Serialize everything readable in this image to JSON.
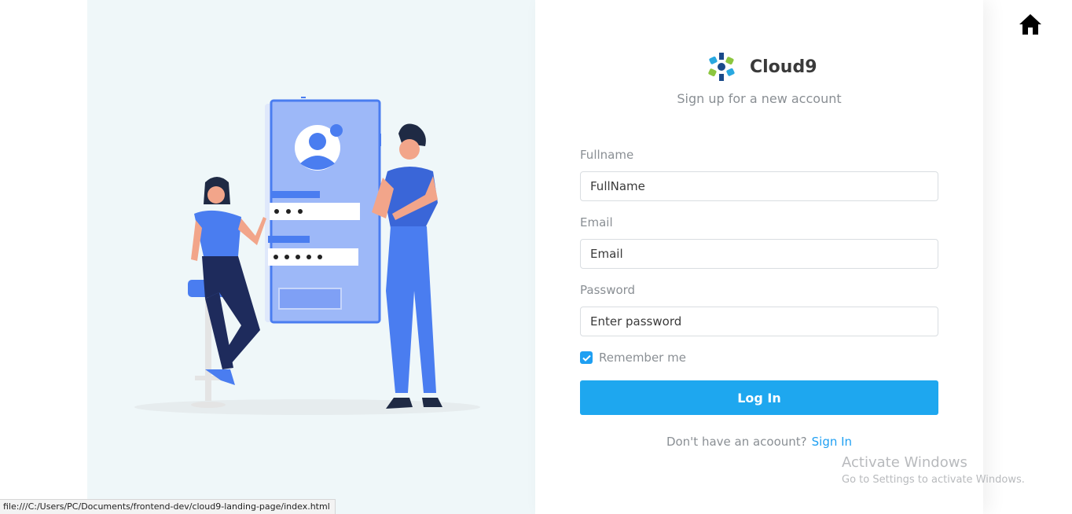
{
  "brand": {
    "name": "Cloud9",
    "subtitle": "Sign up for a new account"
  },
  "form": {
    "fullname": {
      "label": "Fullname",
      "placeholder": "FullName",
      "value": ""
    },
    "email": {
      "label": "Email",
      "placeholder": "Email",
      "value": ""
    },
    "password": {
      "label": "Password",
      "placeholder": "Enter password",
      "value": ""
    },
    "remember": {
      "label": "Remember me",
      "checked": true
    },
    "login_label": "Log In",
    "signup_prompt": "Don't have an acoount?",
    "signup_link": "Sign In"
  },
  "watermark": {
    "title": "Activate Windows",
    "subtitle": "Go to Settings to activate Windows."
  },
  "status_bar": {
    "url": "file:///C:/Users/PC/Documents/frontend-dev/cloud9-landing-page/index.html"
  },
  "colors": {
    "accent": "#1ea7ef",
    "panel_bg": "#eff7f9",
    "illustration_blue": "#4a7df0"
  }
}
